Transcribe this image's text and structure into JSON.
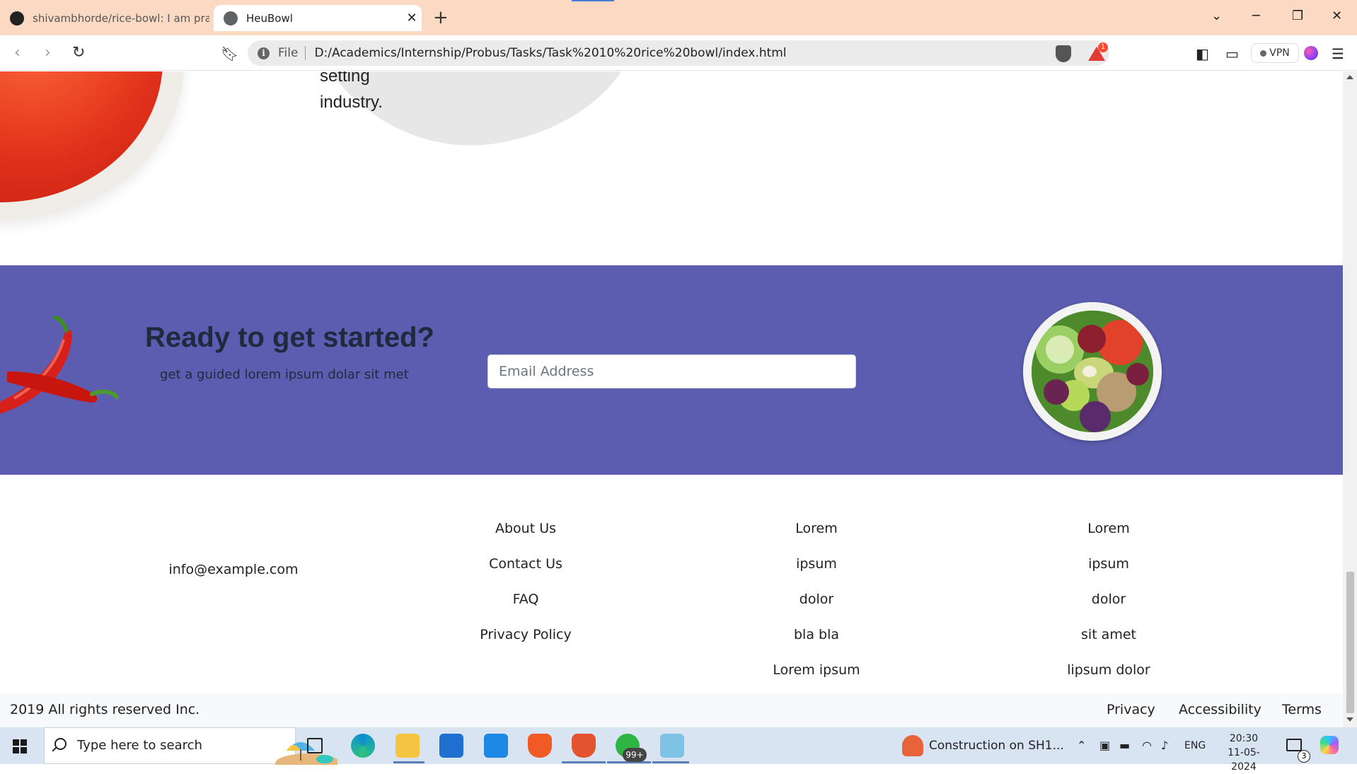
{
  "browser": {
    "tabs": [
      {
        "title": "shivambhorde/rice-bowl: I am practi",
        "active": false,
        "icon": "github-icon"
      },
      {
        "title": "HeuBowl",
        "active": true,
        "icon": "globe-icon"
      }
    ],
    "new_tab_symbol": "+",
    "close_symbol": "✕",
    "scheme_label": "File",
    "url": "D:/Academics/Internship/Probus/Tasks/Task%2010%20rice%20bowl/index.html",
    "rewards_count": "1",
    "vpn_label": "VPN",
    "colors": {
      "tabbar": "#fcd9c2",
      "omnibox": "#ebebeb"
    }
  },
  "page": {
    "blob_text": [
      "setting",
      "industry."
    ],
    "cta": {
      "heading": "Ready to get started?",
      "subtitle": "get a guided lorem ipsum dolar sit met",
      "email_placeholder": "Email Address",
      "background": "#5c5db0"
    },
    "footer": {
      "email": "info@example.com",
      "columns": [
        {
          "links": [
            "About Us",
            "Contact Us",
            "FAQ",
            "Privacy Policy"
          ]
        },
        {
          "links": [
            "Lorem",
            "ipsum",
            "dolor",
            "bla bla",
            "Lorem ipsum"
          ]
        },
        {
          "links": [
            "Lorem",
            "ipsum",
            "dolor",
            "sit amet",
            "lipsum dolor"
          ]
        }
      ],
      "copyright": "2019 All rights reserved Inc.",
      "legal": [
        "Privacy",
        "Accessibility",
        "Terms"
      ]
    }
  },
  "taskbar": {
    "search_placeholder": "Type here to search",
    "whatsapp_badge": "99+",
    "news": "Construction on SH1...",
    "language": "ENG",
    "time": "20:30",
    "date": "11-05-2024",
    "notification_count": "3"
  }
}
